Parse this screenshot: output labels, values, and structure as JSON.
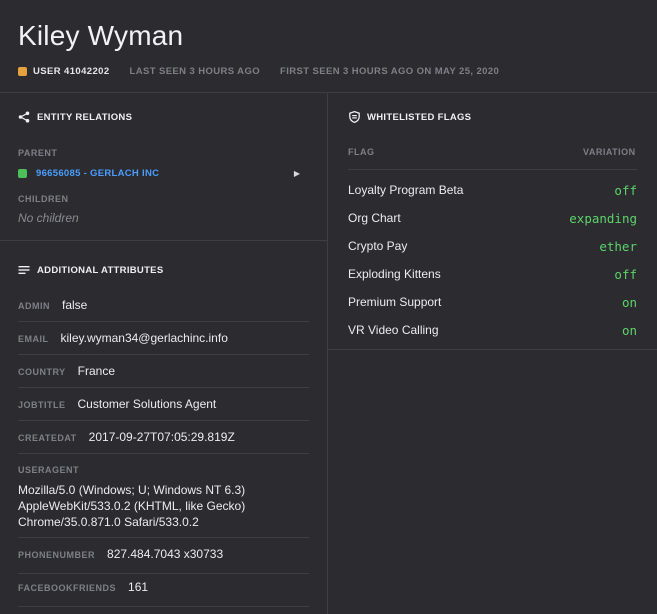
{
  "header": {
    "title": "Kiley Wyman",
    "user_label": "USER 41042202",
    "last_seen": "LAST SEEN 3 HOURS AGO",
    "first_seen": "FIRST SEEN 3 HOURS AGO ON MAY 25, 2020"
  },
  "relations": {
    "title": "ENTITY RELATIONS",
    "icon": "share-icon",
    "parent_label": "PARENT",
    "parent_value": "96656085 - GERLACH INC",
    "children_label": "CHILDREN",
    "children_empty": "No children"
  },
  "attributes": {
    "title": "ADDITIONAL ATTRIBUTES",
    "icon": "list-icon",
    "admin_key": "ADMIN",
    "admin_val": "false",
    "email_key": "EMAIL",
    "email_val": "kiley.wyman34@gerlachinc.info",
    "country_key": "COUNTRY",
    "country_val": "France",
    "jobtitle_key": "JOBTITLE",
    "jobtitle_val": "Customer Solutions Agent",
    "createdat_key": "CREATEDAT",
    "createdat_val": "2017-09-27T07:05:29.819Z",
    "useragent_key": "USERAGENT",
    "useragent_line1": "Mozilla/5.0 (Windows; U; Windows NT 6.3)",
    "useragent_line2": "AppleWebKit/533.0.2 (KHTML, like Gecko)",
    "useragent_line3": "Chrome/35.0.871.0 Safari/533.0.2",
    "phone_key": "PHONENUMBER",
    "phone_val": "827.484.7043 x30733",
    "fb_key": "FACEBOOKFRIENDS",
    "fb_val": "161"
  },
  "flags": {
    "title": "WHITELISTED FLAGS",
    "icon": "shield-icon",
    "col_flag": "FLAG",
    "col_variation": "VARIATION",
    "items": [
      {
        "name": "Loyalty Program Beta",
        "variation": "off"
      },
      {
        "name": "Org Chart",
        "variation": "expanding"
      },
      {
        "name": "Crypto Pay",
        "variation": "ether"
      },
      {
        "name": "Exploding Kittens",
        "variation": "off"
      },
      {
        "name": "Premium Support",
        "variation": "on"
      },
      {
        "name": "VR Video Calling",
        "variation": "on"
      }
    ]
  },
  "colors": {
    "background": "#2b2b30",
    "user_badge": "#e3a23c",
    "parent_badge": "#4cbe5a",
    "link": "#4a9eff",
    "variation": "#5ed36a"
  }
}
